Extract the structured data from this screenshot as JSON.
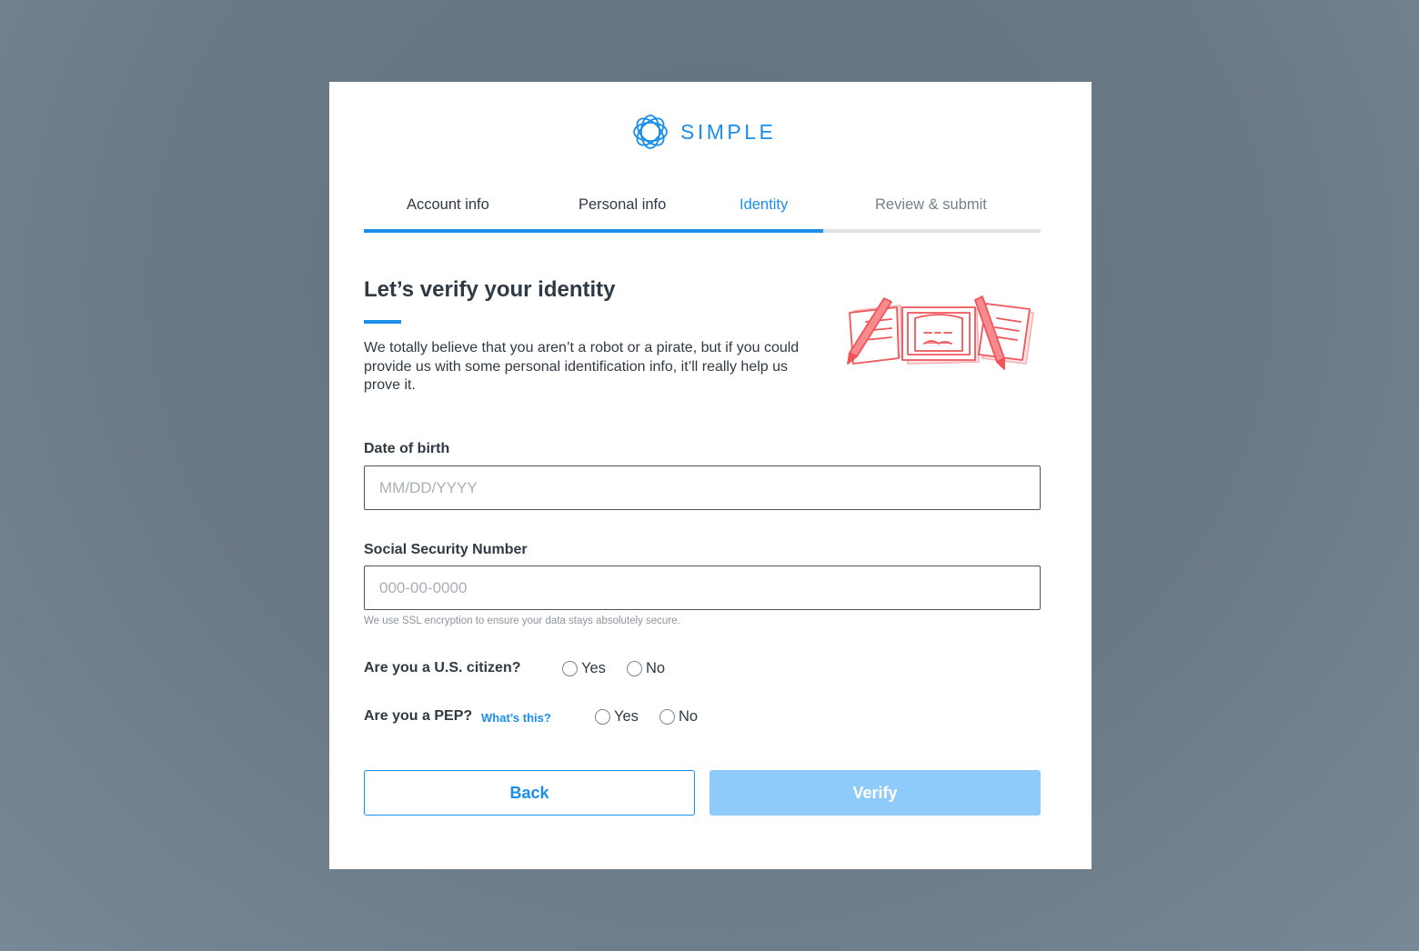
{
  "brand": {
    "name": "SIMPLE",
    "color": "#1a8ee8"
  },
  "steps": {
    "items": [
      {
        "label": "Account info",
        "state": "complete"
      },
      {
        "label": "Personal info",
        "state": "complete"
      },
      {
        "label": "Identity",
        "state": "active"
      },
      {
        "label": "Review & submit",
        "state": "pending"
      }
    ],
    "progress": 0.68
  },
  "main": {
    "heading": "Let’s verify your identity",
    "intro": "We totally believe that you aren’t a robot or a pirate, but if you could provide us with some personal identification info, it’ll really help us prove it.",
    "illustration_icon": "id-documents-illustration"
  },
  "form": {
    "dob": {
      "label": "Date of birth",
      "placeholder": "MM/DD/YYYY",
      "value": ""
    },
    "ssn": {
      "label": "Social Security Number",
      "placeholder": "000-00-0000",
      "value": "",
      "hint": "We use SSL encryption to ensure your data stays absolutely secure."
    },
    "citizen": {
      "question": "Are you a U.S. citizen?",
      "options": [
        "Yes",
        "No"
      ],
      "selected": null
    },
    "pep": {
      "question": "Are you a PEP?",
      "help_link": "What’s this?",
      "options": [
        "Yes",
        "No"
      ],
      "selected": null
    }
  },
  "actions": {
    "back_label": "Back",
    "verify_label": "Verify",
    "verify_enabled": false
  },
  "colors": {
    "accent": "#1a8ee8",
    "accent_disabled": "#8ecbfa",
    "text": "#2f3a45",
    "illustration": "#f0555a"
  }
}
